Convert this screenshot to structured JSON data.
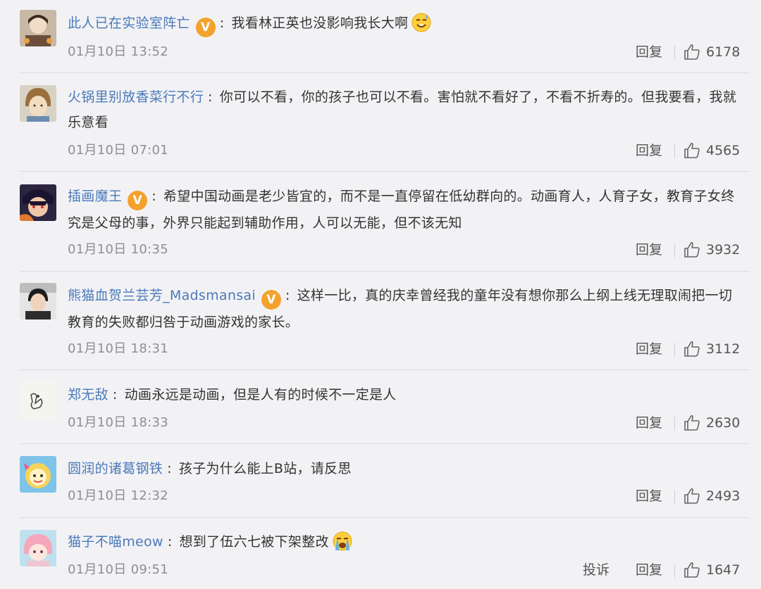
{
  "actions": {
    "reply": "回复",
    "report": "投诉"
  },
  "comments": [
    {
      "user": "此人已在实验室阵亡",
      "verified": true,
      "text": "我看林正英也没影响我长大啊",
      "emoji": true,
      "emoji_name": "sweat-smile-emoji",
      "time": "01月10日 13:52",
      "likes": "6178"
    },
    {
      "user": "火锅里别放香菜行不行",
      "verified": false,
      "text": "你可以不看，你的孩子也可以不看。害怕就不看好了，不看不折寿的。但我要看，我就乐意看",
      "emoji": false,
      "time": "01月10日 07:01",
      "likes": "4565"
    },
    {
      "user": "插画魔王",
      "verified": true,
      "text": "希望中国动画是老少皆宜的，而不是一直停留在低幼群向的。动画育人，人育子女，教育子女终究是父母的事，外界只能起到辅助作用，人可以无能，但不该无知",
      "emoji": false,
      "time": "01月10日 10:35",
      "likes": "3932"
    },
    {
      "user": "熊猫血贺兰芸芳_Madsmansai",
      "verified": true,
      "text": "这样一比，真的庆幸曾经我的童年没有想你那么上纲上线无理取闹把一切教育的失败都归咎于动画游戏的家长。",
      "emoji": false,
      "time": "01月10日 18:31",
      "likes": "3112"
    },
    {
      "user": "郑无敌",
      "verified": false,
      "text": "动画永远是动画，但是人有的时候不一定是人",
      "emoji": false,
      "time": "01月10日 18:33",
      "likes": "2630"
    },
    {
      "user": "圆润的诸葛钢铁",
      "verified": false,
      "text": "孩子为什么能上B站，请反思",
      "emoji": false,
      "time": "01月10日 12:32",
      "likes": "2493"
    },
    {
      "user": "猫子不喵meow",
      "verified": false,
      "text": "想到了伍六七被下架整改",
      "emoji": true,
      "emoji_name": "crying-emoji",
      "time": "01月10日 09:51",
      "likes": "1647",
      "show_report": true
    }
  ]
}
